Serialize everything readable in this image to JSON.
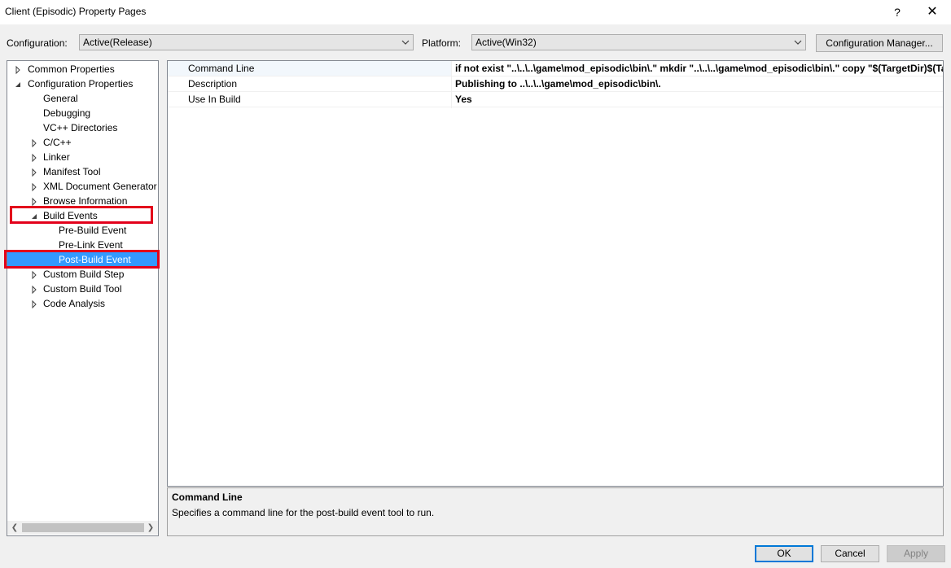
{
  "window": {
    "title": "Client (Episodic) Property Pages",
    "help_label": "?",
    "close_label": "✕"
  },
  "config": {
    "configuration_label": "Configuration:",
    "configuration_value": "Active(Release)",
    "platform_label": "Platform:",
    "platform_value": "Active(Win32)",
    "manager_label": "Configuration Manager..."
  },
  "tree": {
    "items": [
      {
        "label": "Common Properties"
      },
      {
        "label": "Configuration Properties"
      },
      {
        "label": "General"
      },
      {
        "label": "Debugging"
      },
      {
        "label": "VC++ Directories"
      },
      {
        "label": "C/C++"
      },
      {
        "label": "Linker"
      },
      {
        "label": "Manifest Tool"
      },
      {
        "label": "XML Document Generator"
      },
      {
        "label": "Browse Information"
      },
      {
        "label": "Build Events"
      },
      {
        "label": "Pre-Build Event"
      },
      {
        "label": "Pre-Link Event"
      },
      {
        "label": "Post-Build Event"
      },
      {
        "label": "Custom Build Step"
      },
      {
        "label": "Custom Build Tool"
      },
      {
        "label": "Code Analysis"
      }
    ]
  },
  "grid": {
    "rows": [
      {
        "name": "Command Line",
        "value": "if not exist \"..\\..\\..\\game\\mod_episodic\\bin\\.\" mkdir \"..\\..\\..\\game\\mod_episodic\\bin\\.\" copy \"$(TargetDir)$(TargetFileName)\""
      },
      {
        "name": "Description",
        "value": "Publishing to ..\\..\\..\\game\\mod_episodic\\bin\\."
      },
      {
        "name": "Use In Build",
        "value": "Yes"
      }
    ]
  },
  "description": {
    "title": "Command Line",
    "text": "Specifies a command line for the post-build event tool to run."
  },
  "buttons": {
    "ok": "OK",
    "cancel": "Cancel",
    "apply": "Apply"
  },
  "colors": {
    "selection": "#3399ff",
    "highlight_box": "#e3001b"
  }
}
